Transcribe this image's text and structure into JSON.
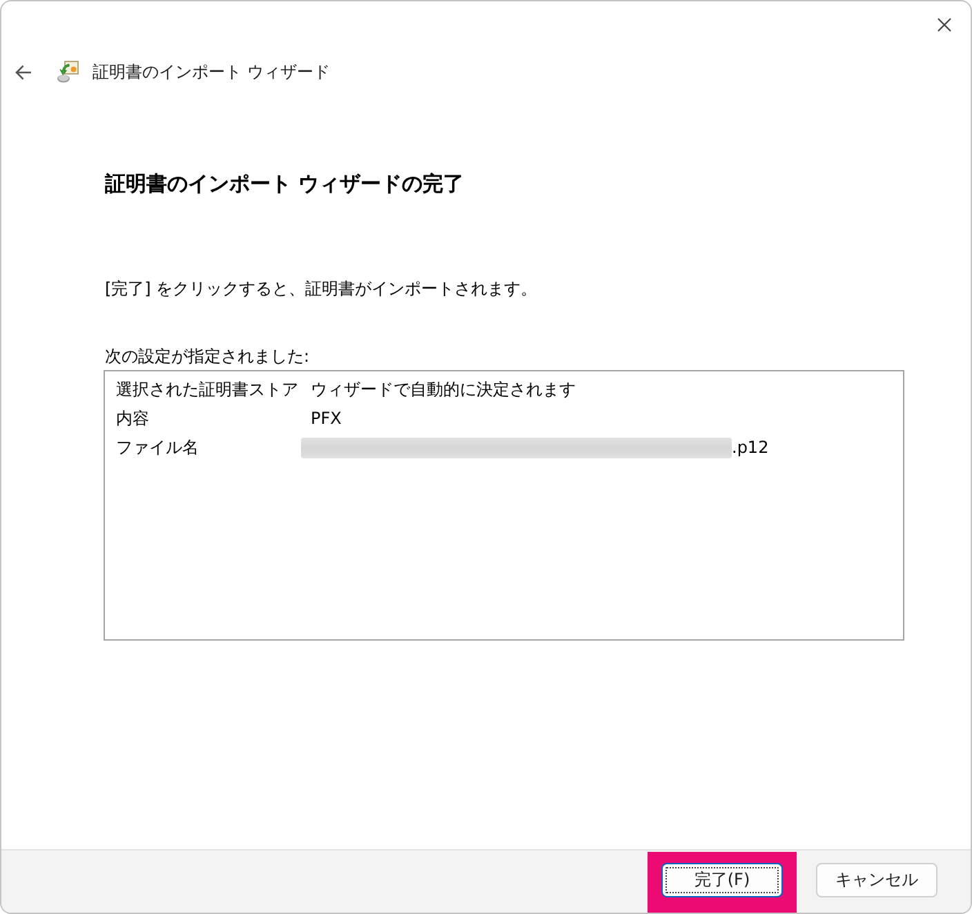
{
  "window": {
    "title": "証明書のインポート ウィザード"
  },
  "heading": "証明書のインポート ウィザードの完了",
  "instruction": "[完了] をクリックすると、証明書がインポートされます。",
  "settings": {
    "label": "次の設定が指定されました:",
    "rows": [
      {
        "name": "選択された証明書ストア",
        "value": "ウィザードで自動的に決定されます",
        "redacted": false
      },
      {
        "name": "内容",
        "value": "PFX",
        "redacted": false
      },
      {
        "name": "ファイル名",
        "value": ".p12",
        "redacted": true
      }
    ]
  },
  "buttons": [
    {
      "label": "完了(F)",
      "default": true,
      "highlighted": true
    },
    {
      "label": "キャンセル",
      "default": false,
      "highlighted": false
    }
  ]
}
